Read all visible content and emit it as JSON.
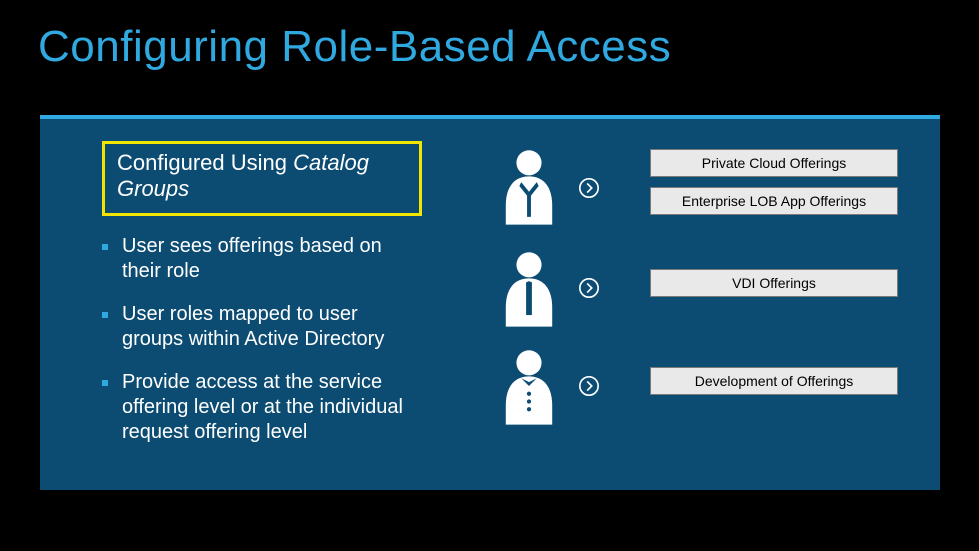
{
  "title": "Configuring Role-Based Access",
  "subtitle_plain": "Configured Using ",
  "subtitle_italic": "Catalog Groups",
  "bullets": [
    "User sees offerings based on their role",
    "User roles mapped to user groups within Active Directory",
    "Provide access at the service offering level or at the individual request offering level"
  ],
  "offerings": {
    "private_cloud": "Private Cloud Offerings",
    "enterprise_lob": "Enterprise LOB App Offerings",
    "vdi": "VDI Offerings",
    "development": "Development of Offerings"
  }
}
